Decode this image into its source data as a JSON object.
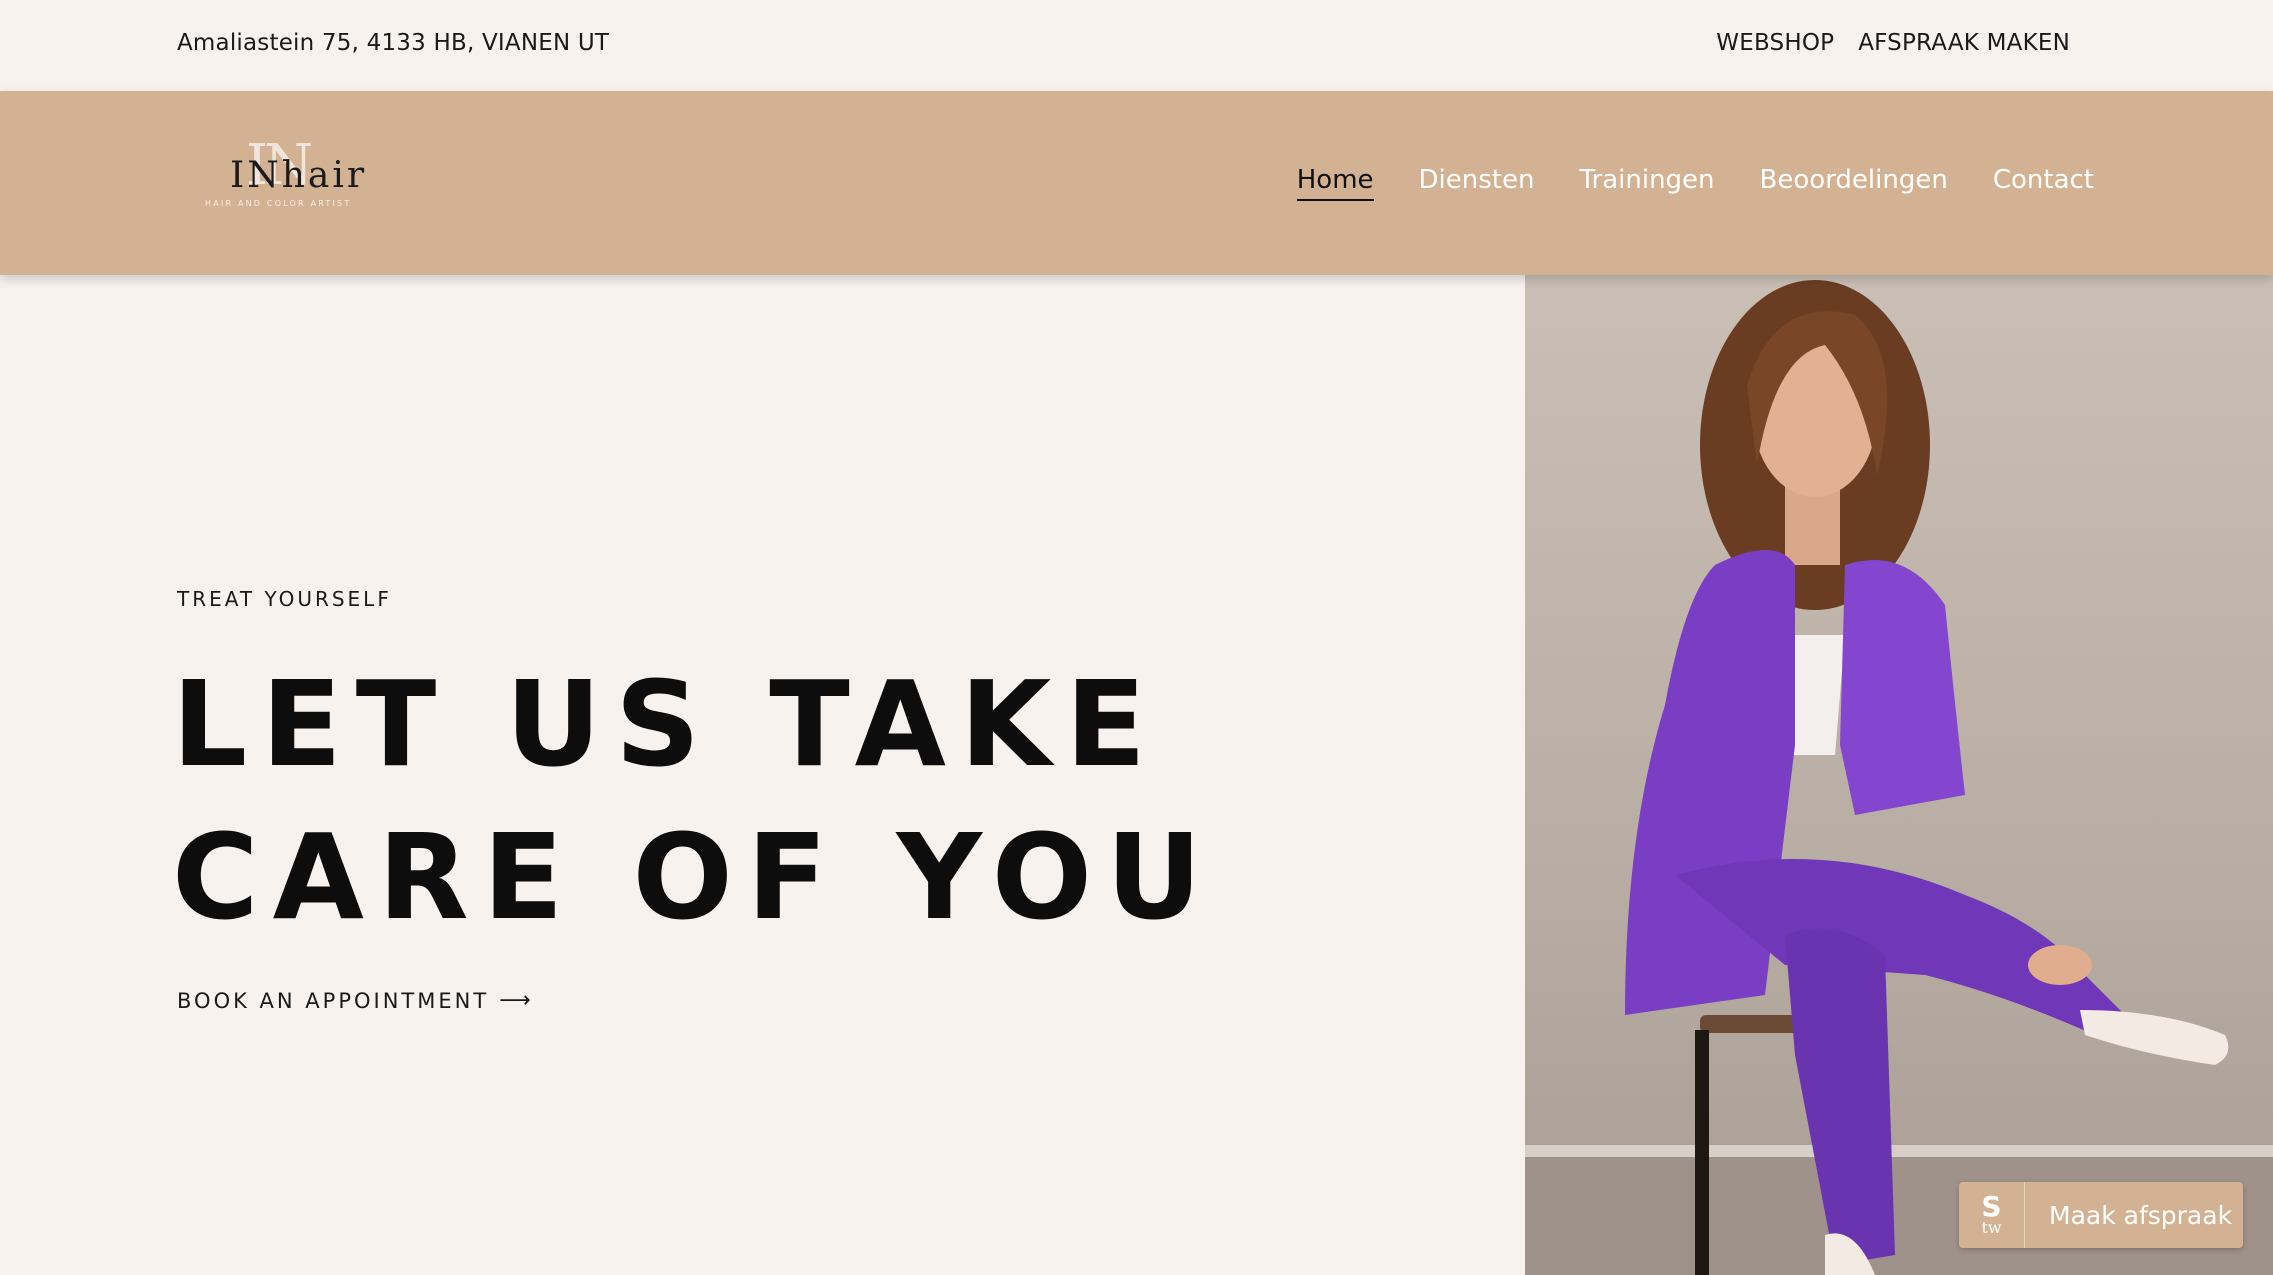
{
  "topbar": {
    "address": "Amaliastein 75, 4133 HB, VIANEN UT",
    "links": [
      "WEBSHOP",
      "AFSPRAAK MAKEN"
    ]
  },
  "header": {
    "logo": {
      "monogram": "IN",
      "wordmark": "INhair",
      "tagline": "HAIR AND COLOR ARTIST"
    },
    "nav": [
      "Home",
      "Diensten",
      "Trainingen",
      "Beoordelingen",
      "Contact"
    ],
    "active_nav": "Home"
  },
  "hero": {
    "eyebrow": "TREAT YOURSELF",
    "headline_line1": "LET US TAKE",
    "headline_line2": "CARE OF YOU",
    "cta": "BOOK AN APPOINTMENT",
    "cta_icon": "arrow-right-icon",
    "image": "woman-in-purple-suit-photo"
  },
  "widget": {
    "icon_top": "S",
    "icon_bottom": "tw",
    "label": "Maak afspraak"
  },
  "colors": {
    "background": "#f7f2ee",
    "header": "#d3b293",
    "text": "#111111",
    "suit": "#7a3ec4"
  }
}
